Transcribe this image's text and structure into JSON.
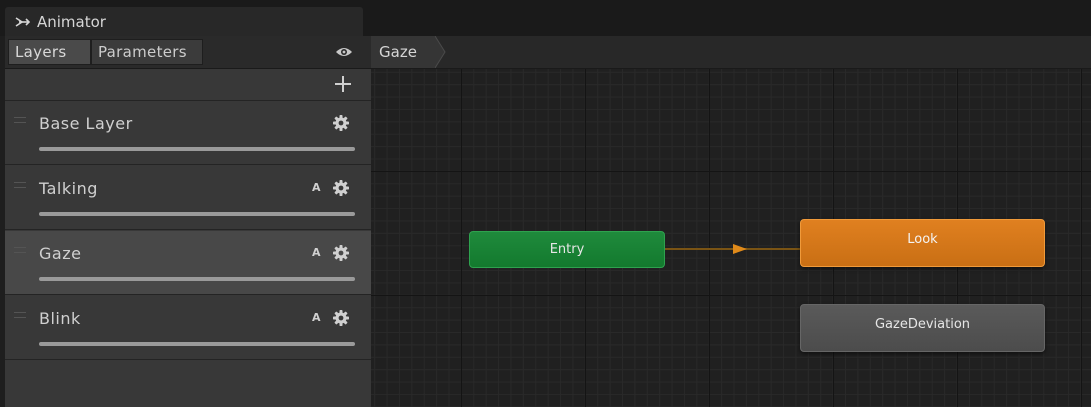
{
  "window": {
    "title": "Animator",
    "title_icon": "animator-icon"
  },
  "left_panel": {
    "tabs": [
      {
        "label": "Layers",
        "active": true
      },
      {
        "label": "Parameters",
        "active": false
      }
    ],
    "eye_icon": "eye-icon",
    "add_icon": "plus-icon",
    "layers": [
      {
        "name": "Base Layer",
        "additive_badge": "",
        "selected": false,
        "weight": 1.0
      },
      {
        "name": "Talking",
        "additive_badge": "A",
        "selected": false,
        "weight": 1.0
      },
      {
        "name": "Gaze",
        "additive_badge": "A",
        "selected": true,
        "weight": 1.0
      },
      {
        "name": "Blink",
        "additive_badge": "A",
        "selected": false,
        "weight": 1.0
      }
    ]
  },
  "graph": {
    "breadcrumb": [
      "Gaze"
    ],
    "states": {
      "entry": {
        "label": "Entry",
        "color": "#1a8436"
      },
      "default": {
        "label": "Look",
        "color": "#d6781a"
      },
      "other": {
        "label": "GazeDeviation",
        "color": "#555555"
      }
    },
    "transition_color": "#8a5a10"
  }
}
